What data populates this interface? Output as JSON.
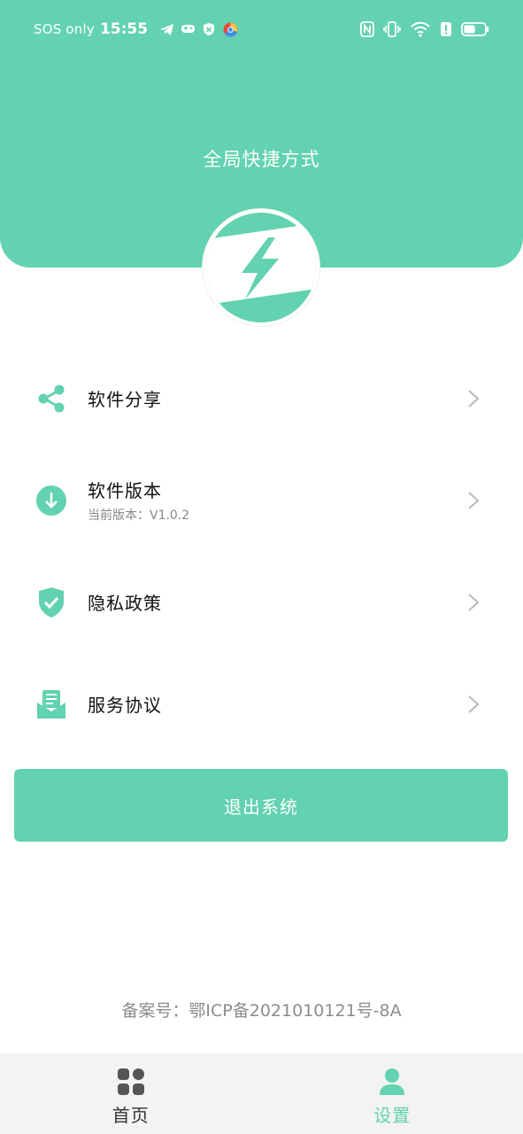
{
  "status_bar": {
    "carrier": "SOS only",
    "time": "15:55",
    "battery_level": 0.55
  },
  "header": {
    "title": "全局快捷方式"
  },
  "menu": {
    "items": [
      {
        "label": "软件分享",
        "sub": "",
        "icon": "share-icon"
      },
      {
        "label": "软件版本",
        "sub": "当前版本：V1.0.2",
        "icon": "download-icon"
      },
      {
        "label": "隐私政策",
        "sub": "",
        "icon": "shield-check-icon"
      },
      {
        "label": "服务协议",
        "sub": "",
        "icon": "document-tray-icon"
      }
    ]
  },
  "logout": {
    "label": "退出系统"
  },
  "footer": {
    "icp": "备案号：鄂ICP备2021010121号-8A"
  },
  "tabbar": {
    "tabs": [
      {
        "label": "首页",
        "icon": "grid-icon",
        "active": false
      },
      {
        "label": "设置",
        "icon": "user-icon",
        "active": true
      }
    ]
  },
  "colors": {
    "accent": "#62d2b0",
    "inactive_text": "#333333",
    "muted_text": "#888888"
  }
}
